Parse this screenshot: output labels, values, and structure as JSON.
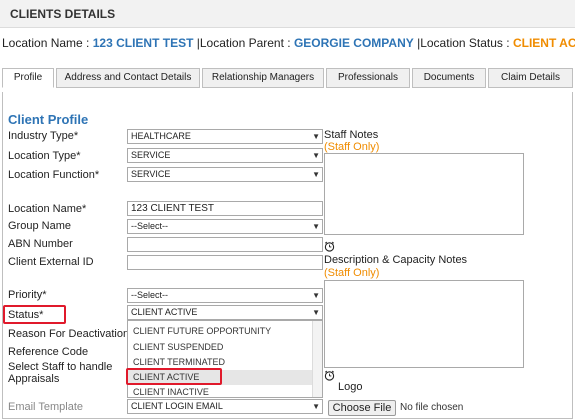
{
  "header": {
    "title": "CLIENTS DETAILS"
  },
  "location_bar": {
    "name_label": "Location Name :",
    "name_value": "123 CLIENT TEST",
    "parent_label": "|Location Parent :",
    "parent_value": "GEORGIE COMPANY",
    "status_label": "|Location Status :",
    "status_value": "CLIENT ACTIVE"
  },
  "tabs": [
    "Profile",
    "Address and Contact Details",
    "Relationship Managers",
    "Professionals",
    "Documents",
    "Claim Details"
  ],
  "profile": {
    "section_title": "Client Profile",
    "fields": {
      "industry_type": {
        "label": "Industry Type*",
        "value": "HEALTHCARE"
      },
      "location_type": {
        "label": "Location Type*",
        "value": "SERVICE"
      },
      "location_function": {
        "label": "Location Function*",
        "value": "SERVICE"
      },
      "location_name": {
        "label": "Location Name*",
        "value": "123 CLIENT TEST"
      },
      "group_name": {
        "label": "Group Name",
        "value": "--Select--"
      },
      "abn_number": {
        "label": "ABN Number",
        "value": ""
      },
      "client_external_id": {
        "label": "Client External ID",
        "value": ""
      },
      "priority": {
        "label": "Priority*",
        "value": "--Select--"
      },
      "status": {
        "label": "Status*",
        "value": "CLIENT ACTIVE"
      },
      "reason_for_deactivation": {
        "label": "Reason For Deactivation"
      },
      "reference_code": {
        "label": "Reference Code"
      },
      "select_staff_line1": {
        "label": "Select Staff to handle"
      },
      "select_staff_line2": {
        "label": "Appraisals"
      },
      "email_template": {
        "label": "Email Template",
        "value": "CLIENT LOGIN EMAIL"
      }
    },
    "status_options": [
      "CLIENT FUTURE OPPORTUNITY",
      "CLIENT SUSPENDED",
      "CLIENT TERMINATED",
      "CLIENT ACTIVE",
      "CLIENT INACTIVE"
    ],
    "status_selected": "CLIENT ACTIVE"
  },
  "right_panel": {
    "staff_notes_label": "Staff Notes",
    "staff_notes_sub": "(Staff Only)",
    "desc_label": "Description & Capacity Notes",
    "desc_sub": "(Staff Only)",
    "logo_label": "Logo",
    "choose_file": "Choose File",
    "no_file": "No file chosen"
  },
  "colors": {
    "accent_blue": "#2e74b5",
    "accent_orange": "#f08c00",
    "highlight_red": "#e0192b"
  }
}
